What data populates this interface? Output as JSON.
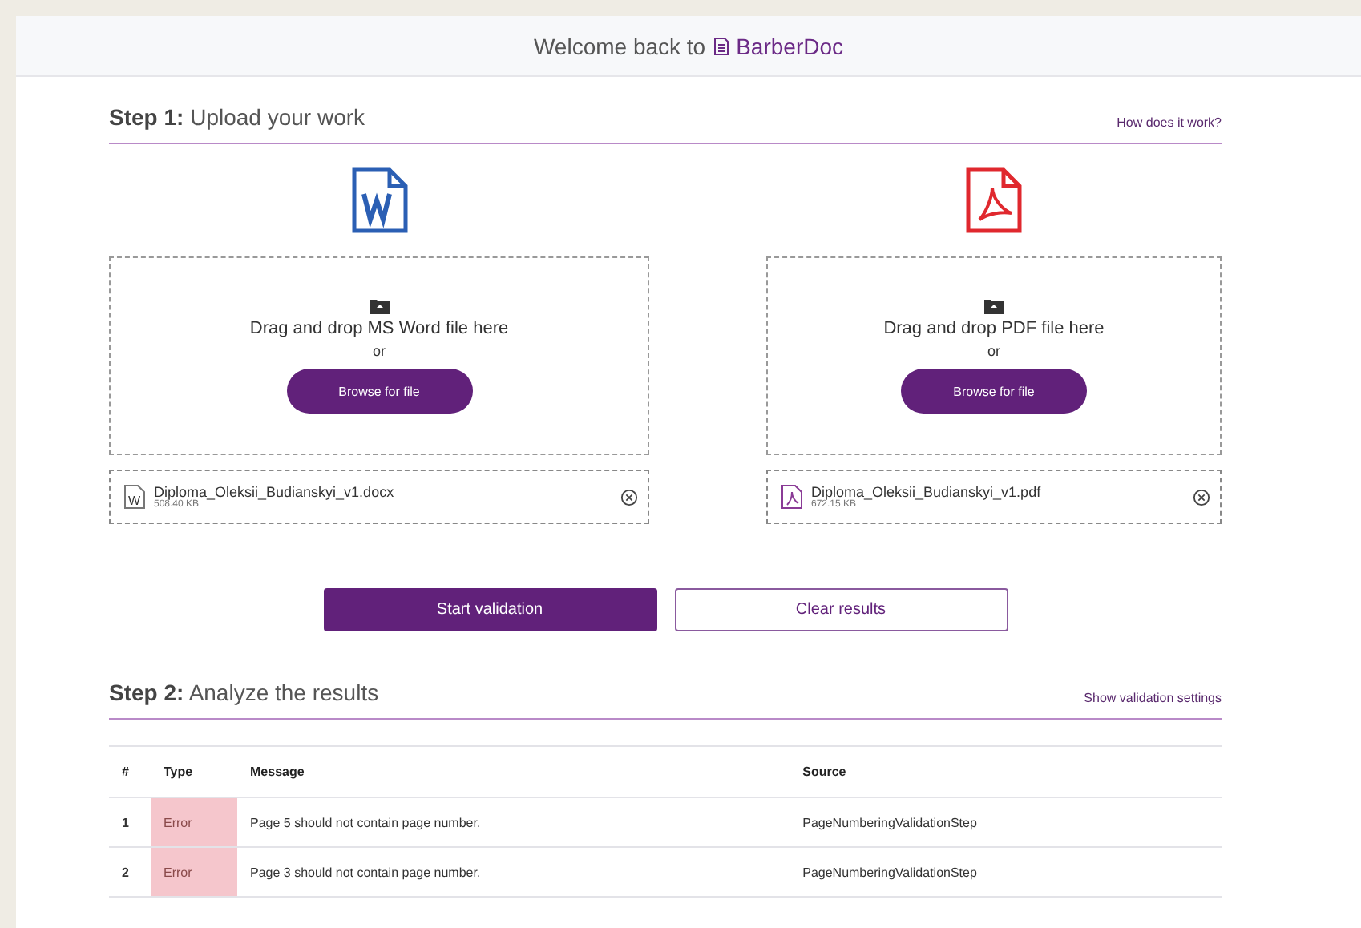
{
  "header": {
    "greeting": "Welcome back to",
    "brand": "BarberDoc"
  },
  "step1": {
    "label": "Step 1:",
    "title": "Upload your work",
    "help_link": "How does it work?"
  },
  "uploads": [
    {
      "kind": "word",
      "drop_text": "Drag and drop MS Word file here",
      "or": "or",
      "browse": "Browse for file",
      "file": {
        "icon_letter": "W",
        "name": "Diploma_Oleksii_Budianskyi_v1.docx",
        "size": "508.40 KB"
      }
    },
    {
      "kind": "pdf",
      "drop_text": "Drag and drop PDF file here",
      "or": "or",
      "browse": "Browse for file",
      "file": {
        "name": "Diploma_Oleksii_Budianskyi_v1.pdf",
        "size": "672.15 KB"
      }
    }
  ],
  "actions": {
    "start": "Start validation",
    "clear": "Clear results"
  },
  "step2": {
    "label": "Step 2:",
    "title": "Analyze the results",
    "settings_link": "Show validation settings"
  },
  "table": {
    "columns": [
      "#",
      "Type",
      "Message",
      "Source"
    ],
    "rows": [
      {
        "num": "1",
        "type": "Error",
        "color": "#f5c6cc",
        "message": "Page 5 should not contain page number.",
        "source": "PageNumberingValidationStep"
      },
      {
        "num": "2",
        "type": "Error",
        "color": "#f5c6cc",
        "message": "Page 3 should not contain page number.",
        "source": "PageNumberingValidationStep"
      }
    ]
  }
}
